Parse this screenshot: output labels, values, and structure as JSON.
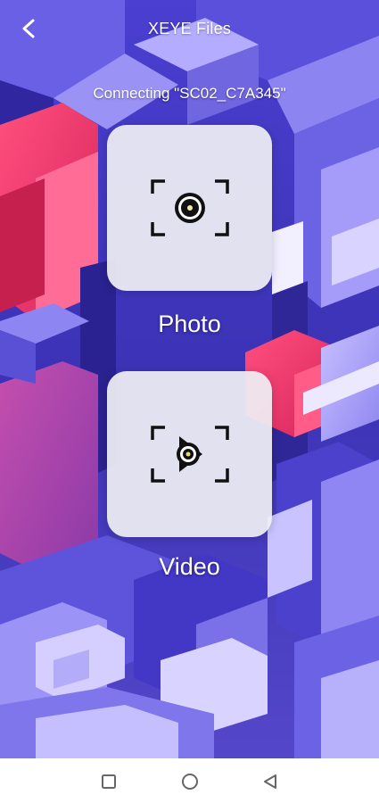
{
  "header": {
    "title": "XEYE Files",
    "back_icon": "chevron-left-icon"
  },
  "status": {
    "text": "Connecting \"SC02_C7A345\""
  },
  "tiles": [
    {
      "label": "Photo",
      "icon": "camera-shutter-icon"
    },
    {
      "label": "Video",
      "icon": "video-camera-icon"
    }
  ],
  "navbar": {
    "items": [
      "square-recent-apps-icon",
      "circle-home-icon",
      "triangle-back-icon"
    ]
  },
  "colors": {
    "tile_bg": "#F0F0F4",
    "text": "#FFFFFF",
    "navbar_bg": "#FFFFFF",
    "nav_icon": "#666666"
  }
}
